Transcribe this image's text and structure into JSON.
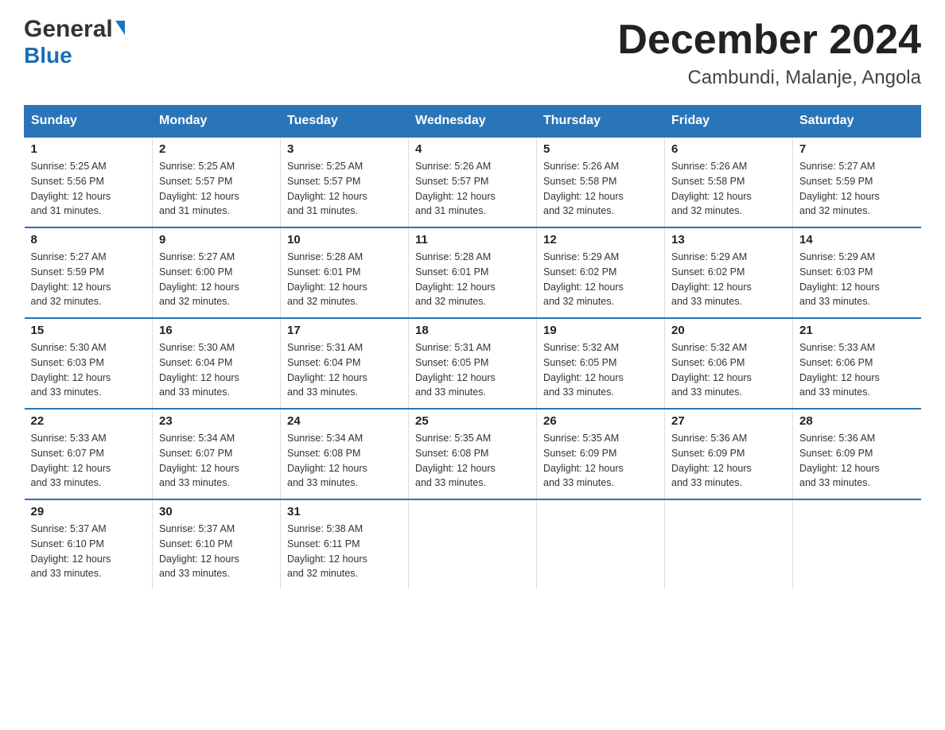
{
  "header": {
    "logo_general": "General",
    "logo_blue": "Blue",
    "title": "December 2024",
    "subtitle": "Cambundi, Malanje, Angola"
  },
  "days_of_week": [
    "Sunday",
    "Monday",
    "Tuesday",
    "Wednesday",
    "Thursday",
    "Friday",
    "Saturday"
  ],
  "weeks": [
    [
      {
        "day": "1",
        "sunrise": "5:25 AM",
        "sunset": "5:56 PM",
        "daylight": "12 hours and 31 minutes."
      },
      {
        "day": "2",
        "sunrise": "5:25 AM",
        "sunset": "5:57 PM",
        "daylight": "12 hours and 31 minutes."
      },
      {
        "day": "3",
        "sunrise": "5:25 AM",
        "sunset": "5:57 PM",
        "daylight": "12 hours and 31 minutes."
      },
      {
        "day": "4",
        "sunrise": "5:26 AM",
        "sunset": "5:57 PM",
        "daylight": "12 hours and 31 minutes."
      },
      {
        "day": "5",
        "sunrise": "5:26 AM",
        "sunset": "5:58 PM",
        "daylight": "12 hours and 32 minutes."
      },
      {
        "day": "6",
        "sunrise": "5:26 AM",
        "sunset": "5:58 PM",
        "daylight": "12 hours and 32 minutes."
      },
      {
        "day": "7",
        "sunrise": "5:27 AM",
        "sunset": "5:59 PM",
        "daylight": "12 hours and 32 minutes."
      }
    ],
    [
      {
        "day": "8",
        "sunrise": "5:27 AM",
        "sunset": "5:59 PM",
        "daylight": "12 hours and 32 minutes."
      },
      {
        "day": "9",
        "sunrise": "5:27 AM",
        "sunset": "6:00 PM",
        "daylight": "12 hours and 32 minutes."
      },
      {
        "day": "10",
        "sunrise": "5:28 AM",
        "sunset": "6:01 PM",
        "daylight": "12 hours and 32 minutes."
      },
      {
        "day": "11",
        "sunrise": "5:28 AM",
        "sunset": "6:01 PM",
        "daylight": "12 hours and 32 minutes."
      },
      {
        "day": "12",
        "sunrise": "5:29 AM",
        "sunset": "6:02 PM",
        "daylight": "12 hours and 32 minutes."
      },
      {
        "day": "13",
        "sunrise": "5:29 AM",
        "sunset": "6:02 PM",
        "daylight": "12 hours and 33 minutes."
      },
      {
        "day": "14",
        "sunrise": "5:29 AM",
        "sunset": "6:03 PM",
        "daylight": "12 hours and 33 minutes."
      }
    ],
    [
      {
        "day": "15",
        "sunrise": "5:30 AM",
        "sunset": "6:03 PM",
        "daylight": "12 hours and 33 minutes."
      },
      {
        "day": "16",
        "sunrise": "5:30 AM",
        "sunset": "6:04 PM",
        "daylight": "12 hours and 33 minutes."
      },
      {
        "day": "17",
        "sunrise": "5:31 AM",
        "sunset": "6:04 PM",
        "daylight": "12 hours and 33 minutes."
      },
      {
        "day": "18",
        "sunrise": "5:31 AM",
        "sunset": "6:05 PM",
        "daylight": "12 hours and 33 minutes."
      },
      {
        "day": "19",
        "sunrise": "5:32 AM",
        "sunset": "6:05 PM",
        "daylight": "12 hours and 33 minutes."
      },
      {
        "day": "20",
        "sunrise": "5:32 AM",
        "sunset": "6:06 PM",
        "daylight": "12 hours and 33 minutes."
      },
      {
        "day": "21",
        "sunrise": "5:33 AM",
        "sunset": "6:06 PM",
        "daylight": "12 hours and 33 minutes."
      }
    ],
    [
      {
        "day": "22",
        "sunrise": "5:33 AM",
        "sunset": "6:07 PM",
        "daylight": "12 hours and 33 minutes."
      },
      {
        "day": "23",
        "sunrise": "5:34 AM",
        "sunset": "6:07 PM",
        "daylight": "12 hours and 33 minutes."
      },
      {
        "day": "24",
        "sunrise": "5:34 AM",
        "sunset": "6:08 PM",
        "daylight": "12 hours and 33 minutes."
      },
      {
        "day": "25",
        "sunrise": "5:35 AM",
        "sunset": "6:08 PM",
        "daylight": "12 hours and 33 minutes."
      },
      {
        "day": "26",
        "sunrise": "5:35 AM",
        "sunset": "6:09 PM",
        "daylight": "12 hours and 33 minutes."
      },
      {
        "day": "27",
        "sunrise": "5:36 AM",
        "sunset": "6:09 PM",
        "daylight": "12 hours and 33 minutes."
      },
      {
        "day": "28",
        "sunrise": "5:36 AM",
        "sunset": "6:09 PM",
        "daylight": "12 hours and 33 minutes."
      }
    ],
    [
      {
        "day": "29",
        "sunrise": "5:37 AM",
        "sunset": "6:10 PM",
        "daylight": "12 hours and 33 minutes."
      },
      {
        "day": "30",
        "sunrise": "5:37 AM",
        "sunset": "6:10 PM",
        "daylight": "12 hours and 33 minutes."
      },
      {
        "day": "31",
        "sunrise": "5:38 AM",
        "sunset": "6:11 PM",
        "daylight": "12 hours and 32 minutes."
      },
      null,
      null,
      null,
      null
    ]
  ],
  "labels": {
    "sunrise": "Sunrise:",
    "sunset": "Sunset:",
    "daylight": "Daylight:"
  }
}
